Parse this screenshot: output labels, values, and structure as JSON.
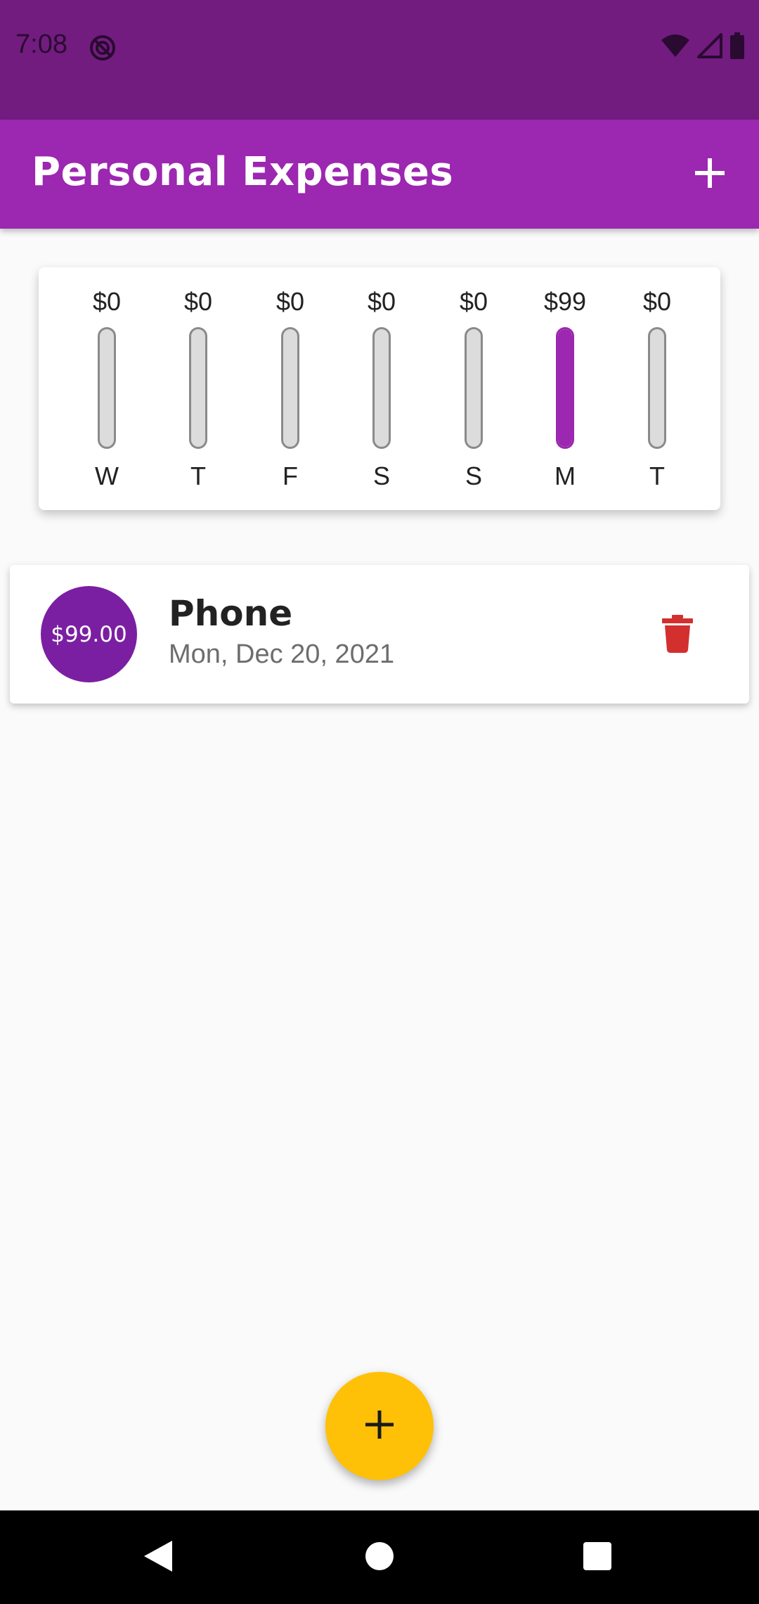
{
  "status_bar": {
    "time": "7:08",
    "icons": [
      "do-not-disturb-icon",
      "wifi-icon",
      "signal-icon",
      "battery-icon"
    ],
    "color": "#721c80"
  },
  "app_bar": {
    "title": "Personal Expenses",
    "add_icon": "plus-icon",
    "color": "#9c27b0"
  },
  "chart": {
    "bars": [
      {
        "day": "W",
        "amount": "$0",
        "fill": 0
      },
      {
        "day": "T",
        "amount": "$0",
        "fill": 0
      },
      {
        "day": "F",
        "amount": "$0",
        "fill": 0
      },
      {
        "day": "S",
        "amount": "$0",
        "fill": 0
      },
      {
        "day": "S",
        "amount": "$0",
        "fill": 0
      },
      {
        "day": "M",
        "amount": "$99",
        "fill": 1
      },
      {
        "day": "T",
        "amount": "$0",
        "fill": 0
      }
    ],
    "fill_color": "#9c27b0",
    "track_color": "#dcdcdc"
  },
  "transactions": [
    {
      "amount": "$99.00",
      "title": "Phone",
      "date": "Mon, Dec 20, 2021",
      "delete_icon": "trash-icon"
    }
  ],
  "colors": {
    "avatar": "#7b1fa2",
    "delete": "#d32f2f",
    "fab": "#ffc107"
  },
  "fab": {
    "icon": "plus-icon"
  },
  "nav_bar": {
    "buttons": [
      "back-icon",
      "home-icon",
      "recents-icon"
    ]
  }
}
